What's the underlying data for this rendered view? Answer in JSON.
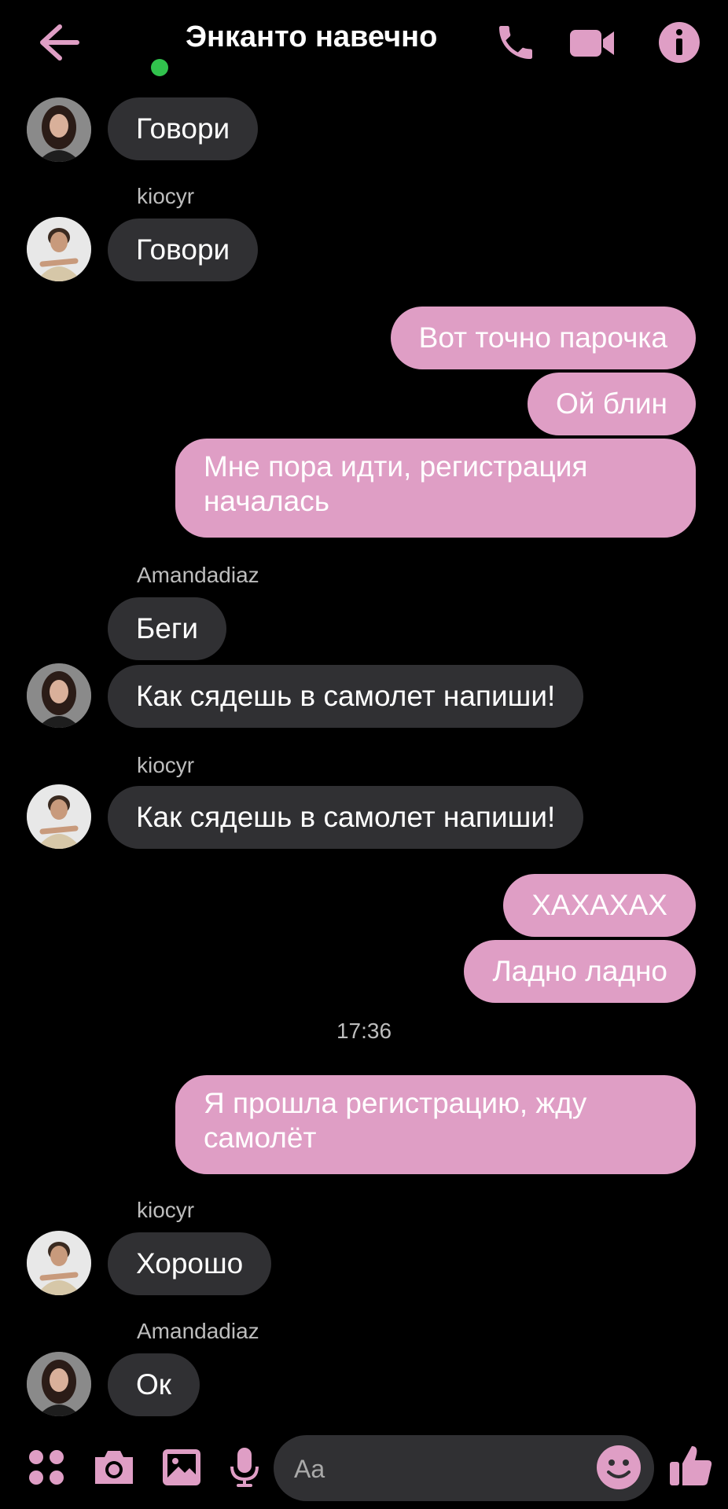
{
  "header": {
    "title": "Энканто навечно",
    "icons": [
      "back-arrow-icon",
      "phone-icon",
      "video-icon",
      "info-icon"
    ]
  },
  "colors": {
    "accent": "#df9ec5",
    "incoming_bubble": "#303033",
    "online": "#31c24d",
    "background": "#000000"
  },
  "messages": [
    {
      "from": "Amandadiaz",
      "text": "Говори"
    },
    {
      "sender_label": "kiocyr",
      "from": "kiocyr",
      "text": "Говори"
    },
    {
      "from": "me",
      "text": "Вот точно парочка"
    },
    {
      "from": "me",
      "text": "Ой блин"
    },
    {
      "from": "me",
      "text": "Мне пора идти, регистрация началась"
    },
    {
      "sender_label": "Amandadiaz",
      "from": "Amandadiaz",
      "text": "Беги"
    },
    {
      "from": "Amandadiaz",
      "text": "Как сядешь в самолет напиши!"
    },
    {
      "sender_label": "kiocyr",
      "from": "kiocyr",
      "text": "Как сядешь в самолет напиши!"
    },
    {
      "from": "me",
      "text": "ХАХАХАХ"
    },
    {
      "from": "me",
      "text": "Ладно ладно"
    },
    {
      "timestamp": "17:36"
    },
    {
      "from": "me",
      "text": "Я прошла регистрацию, жду самолёт"
    },
    {
      "sender_label": "kiocyr",
      "from": "kiocyr",
      "text": "Хорошо"
    },
    {
      "sender_label": "Amandadiaz",
      "from": "Amandadiaz",
      "text": "Ок"
    }
  ],
  "composer": {
    "placeholder": "Aa",
    "icons": [
      "apps-icon",
      "camera-icon",
      "gallery-icon",
      "microphone-icon",
      "emoji-icon",
      "thumbs-up-icon"
    ]
  }
}
